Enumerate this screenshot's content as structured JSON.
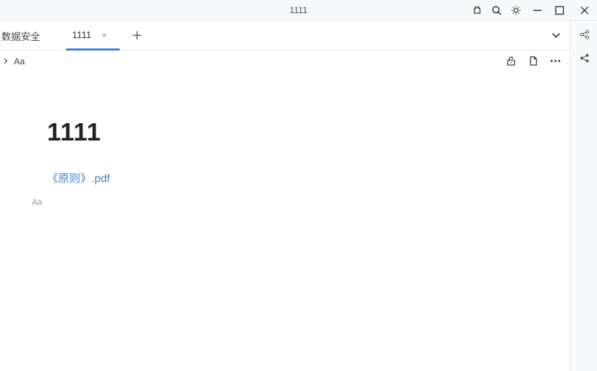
{
  "window": {
    "title": "1111"
  },
  "titlebar_icons": [
    "plugin-icon",
    "search-icon",
    "theme-sun-icon",
    "minimize-icon",
    "maximize-icon",
    "close-icon"
  ],
  "tabs": [
    {
      "label": "数据安全",
      "active": false
    },
    {
      "label": "1111",
      "active": true,
      "close": "×"
    }
  ],
  "toolbar": {
    "font_toggle": "Aa"
  },
  "document": {
    "title": "1111",
    "link_text": "《原则》.pdf",
    "placeholder": "Aa"
  },
  "colors": {
    "accent": "#3d7fd6",
    "title_bar_bg": "#f8f9fa"
  }
}
